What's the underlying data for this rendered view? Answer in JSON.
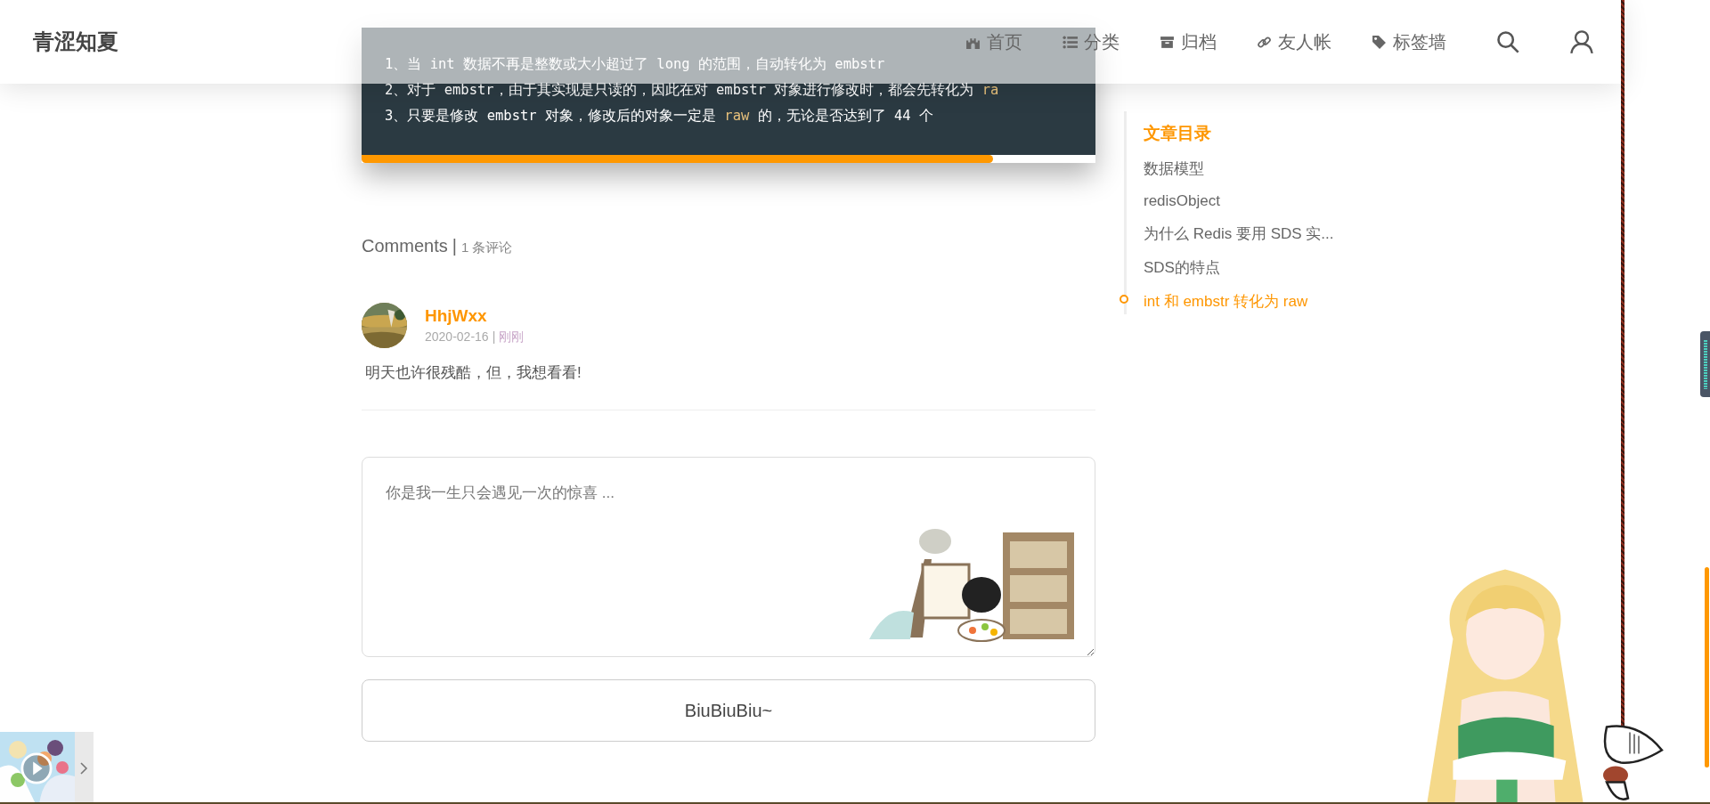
{
  "header": {
    "logo": "青涩知夏",
    "nav": [
      {
        "kind": "home",
        "label": "首页"
      },
      {
        "kind": "list",
        "label": "分类"
      },
      {
        "kind": "archive",
        "label": "归档"
      },
      {
        "kind": "link",
        "label": "友人帐"
      },
      {
        "kind": "tag",
        "label": "标签墙"
      }
    ]
  },
  "code_block": {
    "lines": [
      [
        {
          "kind": "plain",
          "text": "1、当 int 数据不再是整数或大小超过了 long 的范围，自动转化为 embstr"
        }
      ],
      [
        {
          "kind": "plain",
          "text": "2、对于 embstr，由于其实现是只读的，因此在对 embstr 对象进行修改时，都会先转化为 "
        },
        {
          "kind": "keyword",
          "text": "ra"
        }
      ],
      [
        {
          "kind": "plain",
          "text": "3、只要是修改 embstr 对象，修改后的对象一定是 "
        },
        {
          "kind": "keyword",
          "text": "raw"
        },
        {
          "kind": "plain",
          "text": " 的，无论是否达到了 44 个"
        }
      ]
    ],
    "progress": {
      "level": 0.86
    }
  },
  "comments": {
    "title": "Comments",
    "separator": "|",
    "count": "1 条评论",
    "items": [
      {
        "author": "HhjWxx",
        "date": "2020-02-16",
        "separator": "|",
        "time": "刚刚",
        "text": "明天也许很残酷，但，我想看看!"
      }
    ]
  },
  "comment_form": {
    "placeholder": "你是我一生只会遇见一次的惊喜 ...",
    "submit": "BiuBiuBiu~"
  },
  "toc": {
    "title": "文章目录",
    "items": [
      {
        "label": "数据模型",
        "selected": false
      },
      {
        "label": "redisObject",
        "selected": false
      },
      {
        "label": "为什么 Redis 要用 SDS 实...",
        "selected": false
      },
      {
        "label": "SDS的特点",
        "selected": false
      },
      {
        "label": "int 和 embstr 转化为 raw",
        "selected": true
      }
    ]
  }
}
